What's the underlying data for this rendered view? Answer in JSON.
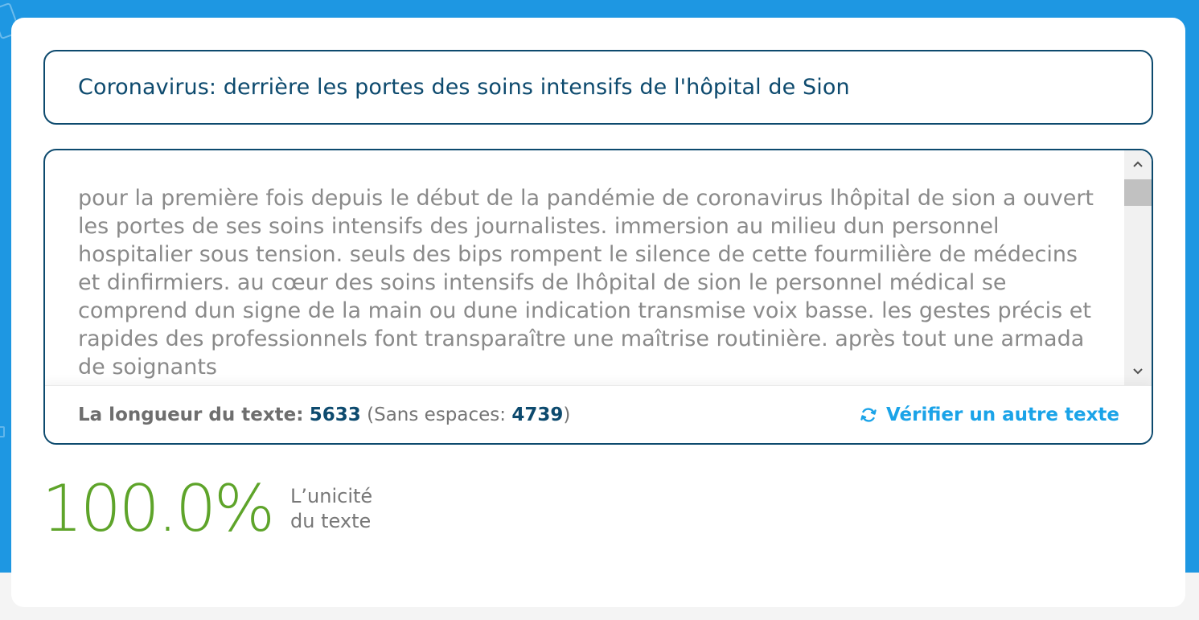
{
  "title": "Coronavirus: derrière les portes des soins intensifs de l'hôpital de Sion",
  "body_text": "pour la première fois depuis le début de la pandémie de coronavirus lhôpital de sion a ouvert les portes de ses soins intensifs des journalistes. immersion au milieu dun personnel hospitalier sous tension. seuls des bips rompent le silence de cette fourmilière de médecins et dinfirmiers. au cœur des soins intensifs de lhôpital de sion le personnel médical se comprend dun signe de la main ou dune indication transmise voix basse. les gestes précis et rapides des professionnels font transparaître une maîtrise routinière. après tout une armada de soignants",
  "length": {
    "label": "La longueur du texte:",
    "value": "5633",
    "no_spaces_prefix": "(Sans espaces:",
    "no_spaces_value": "4739",
    "suffix": ")"
  },
  "verify_label": "Vérifier un autre texte",
  "result": {
    "percent": "100.0%",
    "label_line1": "L’unicité",
    "label_line2": "du texte"
  },
  "icons": {
    "scroll_up": "chevron-up-icon",
    "scroll_down": "chevron-down-icon",
    "refresh": "refresh-icon"
  },
  "colors": {
    "background": "#1e97e2",
    "border": "#0d4a6e",
    "accent_link": "#1aa3e8",
    "result_green": "#5ea42a"
  }
}
